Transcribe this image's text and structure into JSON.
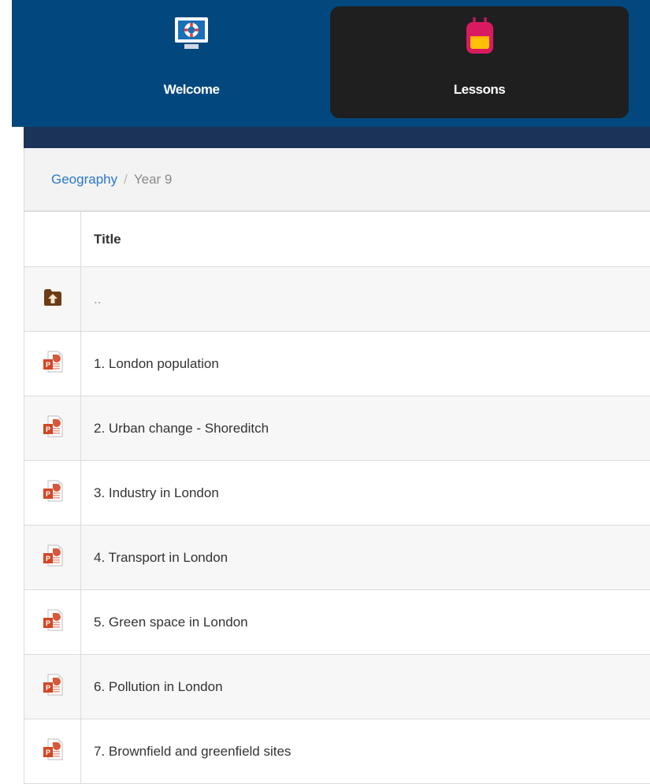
{
  "nav": {
    "items": [
      {
        "label": "Welcome",
        "icon": "monitor-lifebuoy-icon"
      },
      {
        "label": "Lessons",
        "icon": "backpack-icon",
        "active": true
      }
    ]
  },
  "breadcrumb": {
    "link": "Geography",
    "separator": "/",
    "current": "Year 9"
  },
  "table": {
    "header": "Title",
    "parent": {
      "label": "..",
      "icon": "folder-up-icon"
    },
    "rows": [
      {
        "title": "1. London population",
        "icon": "powerpoint-file-icon"
      },
      {
        "title": "2. Urban change - Shoreditch",
        "icon": "powerpoint-file-icon"
      },
      {
        "title": "3. Industry in London",
        "icon": "powerpoint-file-icon"
      },
      {
        "title": "4. Transport in London",
        "icon": "powerpoint-file-icon"
      },
      {
        "title": "5. Green space in London",
        "icon": "powerpoint-file-icon"
      },
      {
        "title": "6. Pollution in London",
        "icon": "powerpoint-file-icon"
      },
      {
        "title": "7. Brownfield and greenfield sites",
        "icon": "powerpoint-file-icon"
      }
    ]
  },
  "colors": {
    "nav_bg": "#02487e",
    "active_tab_bg": "#1f1f1f",
    "title_band_bg": "#1c3359",
    "link": "#2a78c8",
    "ppt_red": "#d24726"
  }
}
